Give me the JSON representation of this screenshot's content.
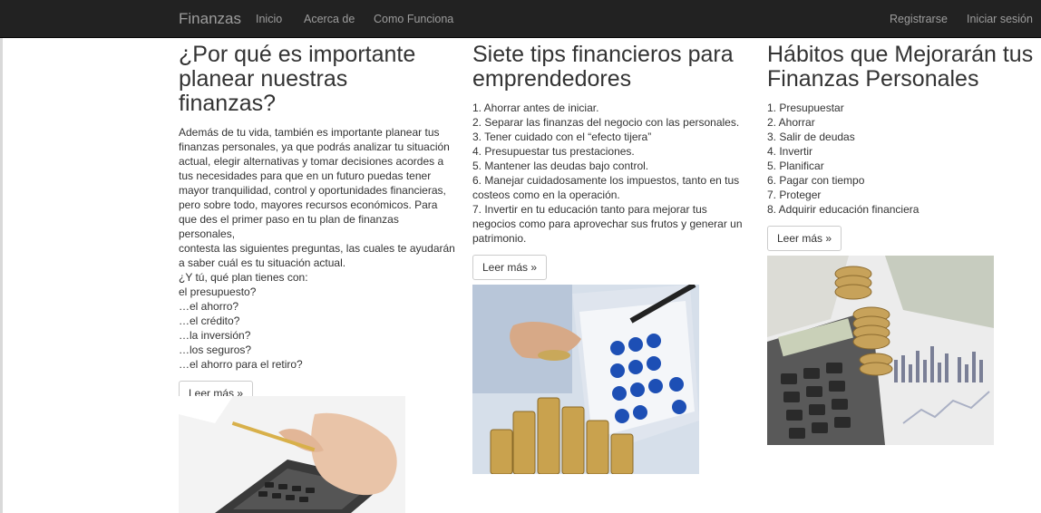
{
  "nav": {
    "brand": "Finanzas",
    "links": [
      "Inicio",
      "Acerca de",
      "Como Funciona"
    ],
    "right": [
      "Registrarse",
      "Iniciar sesión"
    ]
  },
  "columns": [
    {
      "title": "¿Por qué es importante planear nuestras finanzas?",
      "lines": [
        "Además de tu vida, también es importante planear tus",
        "finanzas personales, ya que podrás analizar tu situación",
        "actual, elegir alternativas y tomar decisiones acordes a",
        "tus necesidades para que en un futuro puedas tener",
        "mayor tranquilidad, control y oportunidades financieras,",
        "pero sobre todo, mayores recursos económicos. Para",
        "que des el primer paso en tu plan de finanzas personales,",
        "contesta las siguientes preguntas, las cuales te ayudarán",
        "a saber cuál es tu situación actual.",
        "¿Y tú, qué plan tienes con:",
        "el presupuesto?",
        "…el ahorro?",
        "…el crédito?",
        "…la inversión?",
        "…los seguros?",
        "…el ahorro para el retiro?"
      ],
      "button": "Leer más »"
    },
    {
      "title": "Siete tips financieros para emprendedores",
      "lines": [
        "1. Ahorrar antes de iniciar.",
        "2. Separar las finanzas del negocio con las personales.",
        "3. Tener cuidado con el “efecto tijera”",
        "4. Presupuestar tus prestaciones.",
        "5. Mantener las deudas bajo control.",
        "6. Manejar cuidadosamente los impuestos, tanto en tus",
        "costeos como en la operación.",
        "7. Invertir en tu educación tanto para mejorar tus",
        "negocios como para aprovechar sus frutos y generar un",
        "patrimonio."
      ],
      "button": "Leer más »"
    },
    {
      "title": "Hábitos que Mejorarán tus Finanzas Personales",
      "lines": [
        "1. Presupuestar",
        "2. Ahorrar",
        "3. Salir de deudas",
        "4. Invertir",
        "5. Planificar",
        "6. Pagar con tiempo",
        "7. Proteger",
        "8. Adquirir educación financiera"
      ],
      "button": "Leer más »"
    }
  ]
}
